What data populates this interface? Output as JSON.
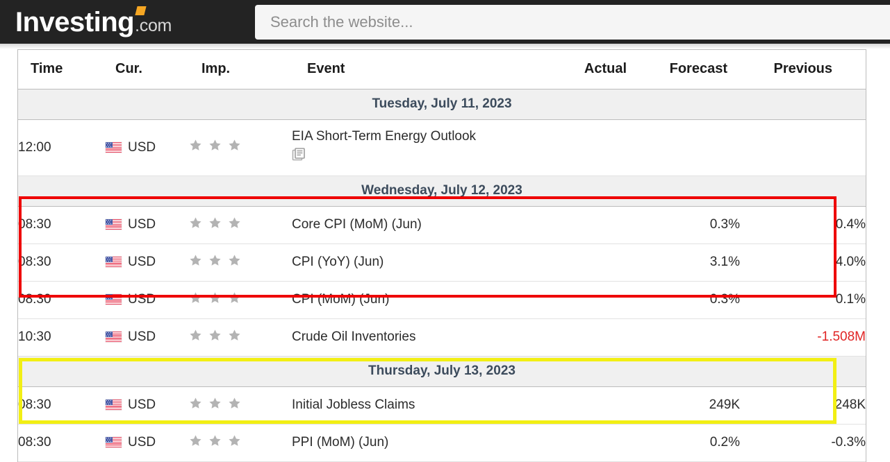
{
  "header": {
    "logo_main": "Investing",
    "logo_suffix": ".com",
    "search_placeholder": "Search the website...",
    "search_value": ""
  },
  "table": {
    "columns": [
      {
        "key": "time",
        "label": "Time"
      },
      {
        "key": "cur",
        "label": "Cur."
      },
      {
        "key": "imp",
        "label": "Imp."
      },
      {
        "key": "event",
        "label": "Event"
      },
      {
        "key": "actual",
        "label": "Actual"
      },
      {
        "key": "forecast",
        "label": "Forecast"
      },
      {
        "key": "previous",
        "label": "Previous"
      }
    ],
    "groups": [
      {
        "date": "Tuesday, July 11, 2023",
        "rows": [
          {
            "time": "12:00",
            "currency": "USD",
            "flag": "us-flag-icon",
            "importance": 3,
            "importance_filled": 0,
            "event": "EIA Short-Term Energy Outlook",
            "has_report_icon": true,
            "actual": "",
            "forecast": "",
            "previous": "",
            "previous_negative": false
          }
        ]
      },
      {
        "date": "Wednesday, July 12, 2023",
        "rows": [
          {
            "time": "08:30",
            "currency": "USD",
            "flag": "us-flag-icon",
            "importance": 3,
            "importance_filled": 0,
            "event": "Core CPI (MoM) (Jun)",
            "has_report_icon": false,
            "actual": "",
            "forecast": "0.3%",
            "previous": "0.4%",
            "previous_negative": false
          },
          {
            "time": "08:30",
            "currency": "USD",
            "flag": "us-flag-icon",
            "importance": 3,
            "importance_filled": 0,
            "event": "CPI (YoY) (Jun)",
            "has_report_icon": false,
            "actual": "",
            "forecast": "3.1%",
            "previous": "4.0%",
            "previous_negative": false
          },
          {
            "time": "08:30",
            "currency": "USD",
            "flag": "us-flag-icon",
            "importance": 3,
            "importance_filled": 0,
            "event": "CPI (MoM) (Jun)",
            "has_report_icon": false,
            "actual": "",
            "forecast": "0.3%",
            "previous": "0.1%",
            "previous_negative": false
          },
          {
            "time": "10:30",
            "currency": "USD",
            "flag": "us-flag-icon",
            "importance": 3,
            "importance_filled": 0,
            "event": "Crude Oil Inventories",
            "has_report_icon": false,
            "actual": "",
            "forecast": "",
            "previous": "-1.508M",
            "previous_negative": true
          }
        ]
      },
      {
        "date": "Thursday, July 13, 2023",
        "rows": [
          {
            "time": "08:30",
            "currency": "USD",
            "flag": "us-flag-icon",
            "importance": 3,
            "importance_filled": 0,
            "event": "Initial Jobless Claims",
            "has_report_icon": false,
            "actual": "",
            "forecast": "249K",
            "previous": "248K",
            "previous_negative": false
          },
          {
            "time": "08:30",
            "currency": "USD",
            "flag": "us-flag-icon",
            "importance": 3,
            "importance_filled": 0,
            "event": "PPI (MoM) (Jun)",
            "has_report_icon": false,
            "actual": "",
            "forecast": "0.2%",
            "previous": "-0.3%",
            "previous_negative": false
          }
        ]
      }
    ]
  },
  "annotations": [
    {
      "name": "red-highlight-box",
      "color": "#ee0000",
      "covers": [
        "Core CPI (MoM) (Jun)",
        "CPI (YoY) (Jun)",
        "CPI (MoM) (Jun)"
      ]
    },
    {
      "name": "yellow-highlight-box",
      "color": "#f2ef14",
      "covers": [
        "Initial Jobless Claims",
        "PPI (MoM) (Jun)"
      ]
    }
  ],
  "colors": {
    "header_bg": "#232323",
    "logo_accent": "#f5a623",
    "day_header_text": "#3c4b5c",
    "day_header_bg": "#f0f0f0",
    "negative_value": "#e02424",
    "star_empty": "#b3b3b3"
  }
}
